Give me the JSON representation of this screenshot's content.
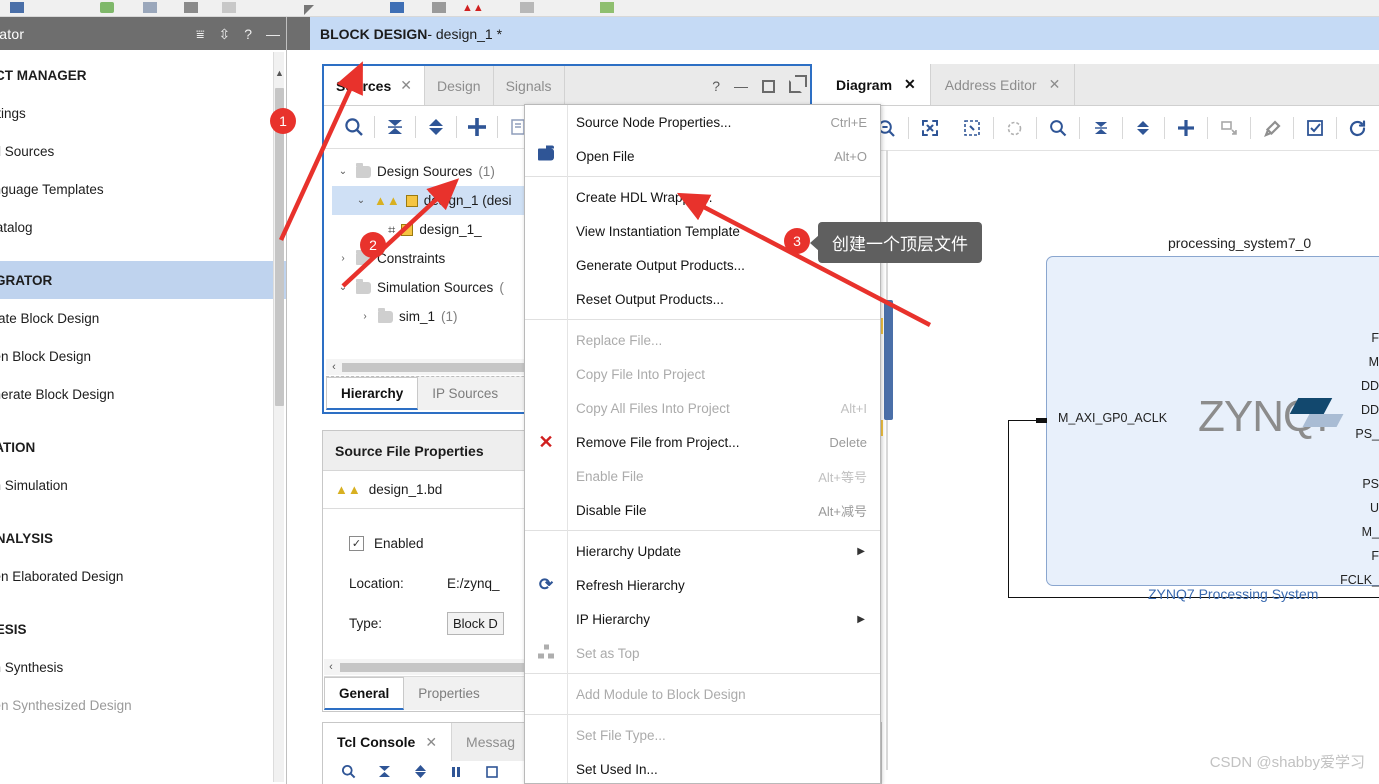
{
  "window": {
    "block_design_title_bold": "BLOCK DESIGN",
    "block_design_title_rest": " - design_1 *"
  },
  "flow_navigator": {
    "title": "igator",
    "header_icons": [
      "collapse-all-icon",
      "expand-all-icon",
      "help-icon",
      "minimize-icon"
    ],
    "items": [
      {
        "label": "ECT MANAGER",
        "type": "section"
      },
      {
        "label": "ettings",
        "type": "item"
      },
      {
        "label": "dd Sources",
        "type": "item"
      },
      {
        "label": "anguage Templates",
        "type": "item"
      },
      {
        "label": "Catalog",
        "type": "item"
      },
      {
        "label": "EGRATOR",
        "type": "section-highlight"
      },
      {
        "label": "reate Block Design",
        "type": "item"
      },
      {
        "label": "pen Block Design",
        "type": "item"
      },
      {
        "label": "enerate Block Design",
        "type": "item"
      },
      {
        "label": "LATION",
        "type": "section"
      },
      {
        "label": "un Simulation",
        "type": "item"
      },
      {
        "label": "ANALYSIS",
        "type": "section"
      },
      {
        "label": "pen Elaborated Design",
        "type": "item"
      },
      {
        "label": "HESIS",
        "type": "section"
      },
      {
        "label": "un Synthesis",
        "type": "item"
      },
      {
        "label": "pen Synthesized Design",
        "type": "item-disabled"
      }
    ]
  },
  "sources_panel": {
    "tabs": [
      {
        "label": "Sources",
        "active": true,
        "closable": true
      },
      {
        "label": "Design",
        "active": false,
        "closable": false
      },
      {
        "label": "Signals",
        "active": false,
        "closable": false
      }
    ],
    "window_controls": [
      "help-icon",
      "minimize-icon",
      "maximize-icon",
      "float-icon"
    ],
    "toolbar_icons": [
      "search-icon",
      "collapse-all-icon",
      "expand-all-icon",
      "add-sources-icon",
      "properties-icon"
    ],
    "tree": [
      {
        "label": "Design Sources",
        "count": "(1)",
        "indent": 0,
        "expanded": true,
        "icon": "folder-icon",
        "selected": false
      },
      {
        "label": "design_1 (desi",
        "count": "",
        "indent": 1,
        "expanded": true,
        "icon": "block-design-icon",
        "selected": true
      },
      {
        "label": "design_1_",
        "count": "",
        "indent": 2,
        "expanded": null,
        "icon": "module-icon",
        "selected": false
      },
      {
        "label": "Constraints",
        "count": "",
        "indent": 0,
        "expanded": false,
        "icon": "folder-icon",
        "selected": false
      },
      {
        "label": "Simulation Sources",
        "count": "(",
        "indent": 0,
        "expanded": true,
        "icon": "folder-icon",
        "selected": false
      },
      {
        "label": "sim_1",
        "count": "(1)",
        "indent": 1,
        "expanded": false,
        "icon": "folder-icon",
        "selected": false
      }
    ],
    "bottom_tabs": [
      {
        "label": "Hierarchy",
        "active": true
      },
      {
        "label": "IP Sources",
        "active": false
      }
    ]
  },
  "source_file_properties": {
    "title": "Source File Properties",
    "file_name": "design_1.bd",
    "enabled_label": "Enabled",
    "enabled_checked": true,
    "location_label": "Location:",
    "location_value": "E:/zynq_",
    "type_label": "Type:",
    "type_value": "Block D",
    "tabs": [
      {
        "label": "General",
        "active": true
      },
      {
        "label": "Properties",
        "active": false
      }
    ]
  },
  "tcl_console": {
    "tabs": [
      {
        "label": "Tcl Console",
        "active": true,
        "closable": true
      },
      {
        "label": "Messag",
        "active": false,
        "closable": false
      }
    ]
  },
  "context_menu": {
    "items": [
      {
        "label": "Source Node Properties...",
        "accel": "Ctrl+E",
        "disabled": false,
        "icon": "",
        "submenu": false
      },
      {
        "label": "Open File",
        "accel": "Alt+O",
        "disabled": false,
        "icon": "folder-open-icon",
        "submenu": false
      },
      {
        "separator": true
      },
      {
        "label": "Create HDL Wrapper...",
        "accel": "",
        "disabled": false,
        "icon": "",
        "submenu": false
      },
      {
        "label": "View Instantiation Template",
        "accel": "",
        "disabled": false,
        "icon": "",
        "submenu": false
      },
      {
        "label": "Generate Output Products...",
        "accel": "",
        "disabled": false,
        "icon": "",
        "submenu": false
      },
      {
        "label": "Reset Output Products...",
        "accel": "",
        "disabled": false,
        "icon": "",
        "submenu": false
      },
      {
        "separator": true
      },
      {
        "label": "Replace File...",
        "accel": "",
        "disabled": true,
        "icon": "",
        "submenu": false
      },
      {
        "label": "Copy File Into Project",
        "accel": "",
        "disabled": true,
        "icon": "",
        "submenu": false
      },
      {
        "label": "Copy All Files Into Project",
        "accel": "Alt+I",
        "disabled": true,
        "icon": "",
        "submenu": false
      },
      {
        "label": "Remove File from Project...",
        "accel": "Delete",
        "disabled": false,
        "icon": "remove-x-icon",
        "submenu": false
      },
      {
        "label": "Enable File",
        "accel": "Alt+等号",
        "disabled": true,
        "icon": "",
        "submenu": false
      },
      {
        "label": "Disable File",
        "accel": "Alt+减号",
        "disabled": false,
        "icon": "",
        "submenu": false
      },
      {
        "separator": true
      },
      {
        "label": "Hierarchy Update",
        "accel": "",
        "disabled": false,
        "icon": "",
        "submenu": true
      },
      {
        "label": "Refresh Hierarchy",
        "accel": "",
        "disabled": false,
        "icon": "refresh-icon",
        "submenu": false
      },
      {
        "label": "IP Hierarchy",
        "accel": "",
        "disabled": false,
        "icon": "",
        "submenu": true
      },
      {
        "label": "Set as Top",
        "accel": "",
        "disabled": true,
        "icon": "set-as-top-icon",
        "submenu": false
      },
      {
        "separator": true
      },
      {
        "label": "Add Module to Block Design",
        "accel": "",
        "disabled": true,
        "icon": "",
        "submenu": false
      },
      {
        "separator": true
      },
      {
        "label": "Set File Type...",
        "accel": "",
        "disabled": true,
        "icon": "",
        "submenu": false
      },
      {
        "label": "Set Used In...",
        "accel": "",
        "disabled": false,
        "icon": "",
        "submenu": false
      }
    ]
  },
  "diagram_panel": {
    "tabs": [
      {
        "label": "Diagram",
        "active": true,
        "closable": true
      },
      {
        "label": "Address Editor",
        "active": false,
        "closable": true
      }
    ],
    "toolbar_icons": [
      "zoom-out-icon",
      "fit-to-screen-icon",
      "zoom-area-icon",
      "zoom-target-icon",
      "search-icon",
      "collapse-all-icon",
      "expand-all-icon",
      "add-ip-icon",
      "create-port-icon",
      "run-connection-automation-icon",
      "validate-design-icon",
      "regenerate-layout-icon"
    ]
  },
  "block_diagram": {
    "instance_name": "processing_system7_0",
    "logo_text": "ZYNQ",
    "logo_dot": ".",
    "subtitle": "ZYNQ7 Processing System",
    "input_port": "M_AXI_GP0_ACLK",
    "output_ports_truncated": [
      "F",
      "M",
      "DD",
      "DD",
      "PS_",
      "PS",
      "U",
      "M_",
      "F",
      "FCLK_"
    ]
  },
  "annotations": {
    "badges": [
      {
        "number": "1"
      },
      {
        "number": "2"
      },
      {
        "number": "3"
      }
    ],
    "tooltip_text": "创建一个顶层文件"
  },
  "watermark": "CSDN @shabby爱学习"
}
